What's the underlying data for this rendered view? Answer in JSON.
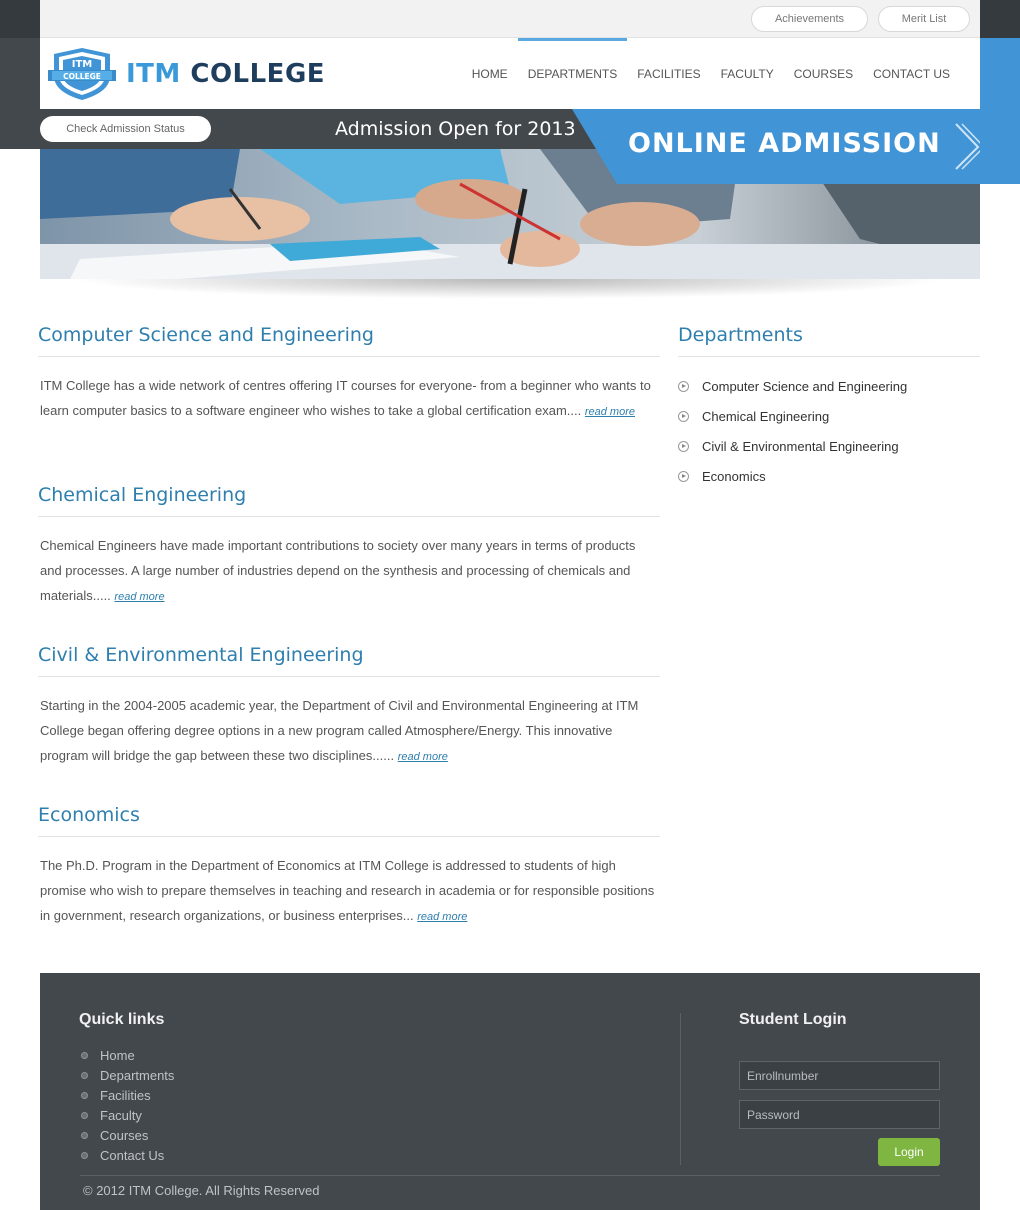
{
  "utility": {
    "achievements_label": "Achievements",
    "merit_list_label": "Merit List"
  },
  "logo": {
    "badge_top": "ITM",
    "badge_bottom": "COLLEGE",
    "title_part1": "ITM",
    "title_part2": "COLLEGE"
  },
  "nav": {
    "items": [
      "HOME",
      "DEPARTMENTS",
      "FACILITIES",
      "FACULTY",
      "COURSES",
      "CONTACT US"
    ],
    "active": "DEPARTMENTS"
  },
  "admission": {
    "check_status_label": "Check Admission Status",
    "open_text": "Admission Open for 2013",
    "online_label": "ONLINE ADMISSION"
  },
  "departments": [
    {
      "title": "Computer Science and Engineering",
      "text": "ITM College has a wide network of centres offering IT courses for everyone- from a beginner who wants to learn computer basics to a software engineer who wishes to take a global certification exam....",
      "link": "read more"
    },
    {
      "title": "Chemical Engineering",
      "text": "Chemical Engineers have made important contributions to society over many years in terms of products and processes. A large number of industries depend on the synthesis and processing of chemicals and materials.....",
      "link": "read more"
    },
    {
      "title": "Civil & Environmental Engineering",
      "text": "Starting in the 2004-2005 academic year, the Department of Civil and Environmental Engineering at ITM College began offering degree options in a new program called Atmosphere/Energy. This innovative program will bridge the gap between these two disciplines......",
      "link": "read more"
    },
    {
      "title": "Economics",
      "text": "The Ph.D. Program in the Department of Economics at ITM College is addressed to students of high promise who wish to prepare themselves in teaching and research in academia or for responsible positions in government, research organizations, or business enterprises...",
      "link": "read more"
    }
  ],
  "sidebar": {
    "title": "Departments",
    "items": [
      "Computer Science and Engineering",
      "Chemical Engineering",
      "Civil & Environmental Engineering",
      "Economics"
    ]
  },
  "footer": {
    "quick_links_title": "Quick links",
    "quick_links": [
      "Home",
      "Departments",
      "Facilities",
      "Faculty",
      "Courses",
      "Contact Us"
    ],
    "student_login_title": "Student Login",
    "enroll_placeholder": "Enrollnumber",
    "password_placeholder": "Password",
    "login_label": "Login",
    "copyright": "© 2012 ITM College. All Rights Reserved"
  },
  "colors": {
    "accent_blue": "#4195d6",
    "heading_blue": "#2f7fae",
    "dark_band": "#43484d",
    "login_green": "#7eb641"
  }
}
